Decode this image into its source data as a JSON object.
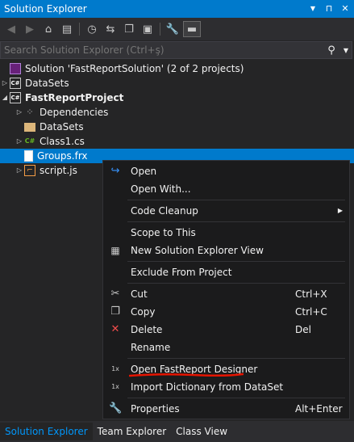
{
  "window": {
    "title": "Solution Explorer",
    "controls": {
      "dropdown": "▼",
      "pin": "⊓",
      "close": "✕"
    }
  },
  "toolbar": {
    "icons": [
      "back-icon",
      "forward-icon",
      "home-icon",
      "switch-views-icon",
      "pending-changes-icon",
      "sync-icon",
      "collapse-all-icon",
      "show-all-files-icon",
      "properties-icon",
      "preview-icon"
    ]
  },
  "search": {
    "placeholder": "Search Solution Explorer (Ctrl+ş)"
  },
  "tree": {
    "solution_label": "Solution 'FastReportSolution' (2 of 2 projects)",
    "items": [
      {
        "label": "DataSets"
      },
      {
        "label": "FastReportProject"
      },
      {
        "label": "Dependencies"
      },
      {
        "label": "DataSets"
      },
      {
        "label": "Class1.cs"
      },
      {
        "label": "Groups.frx"
      },
      {
        "label": "script.js"
      }
    ],
    "cs_badge": "C#"
  },
  "context_menu": {
    "items": [
      {
        "label": "Open",
        "icon": "open-arrow-icon"
      },
      {
        "label": "Open With..."
      },
      {
        "label": "Code Cleanup",
        "submenu": "▶"
      },
      {
        "label": "Scope to This"
      },
      {
        "label": "New Solution Explorer View",
        "icon": "new-view-icon"
      },
      {
        "label": "Exclude From Project"
      },
      {
        "label": "Cut",
        "shortcut": "Ctrl+X",
        "icon": "scissors-icon"
      },
      {
        "label": "Copy",
        "shortcut": "Ctrl+C",
        "icon": "copy-icon"
      },
      {
        "label": "Delete",
        "shortcut": "Del",
        "icon": "delete-x-icon"
      },
      {
        "label": "Rename"
      },
      {
        "label": "Open FastReport Designer",
        "icon": "fastreport-icon"
      },
      {
        "label": "Import Dictionary from DataSet",
        "icon": "fastreport-icon"
      },
      {
        "label": "Properties",
        "shortcut": "Alt+Enter",
        "icon": "wrench-icon"
      }
    ],
    "fastreport_glyph": "1x",
    "highlight_color": "#e51400"
  },
  "bottom_tabs": [
    {
      "label": "Solution Explorer",
      "active": true
    },
    {
      "label": "Team Explorer"
    },
    {
      "label": "Class View"
    }
  ],
  "colors": {
    "accent": "#007acc",
    "background": "#252526",
    "menu_bg": "#1b1b1c"
  }
}
